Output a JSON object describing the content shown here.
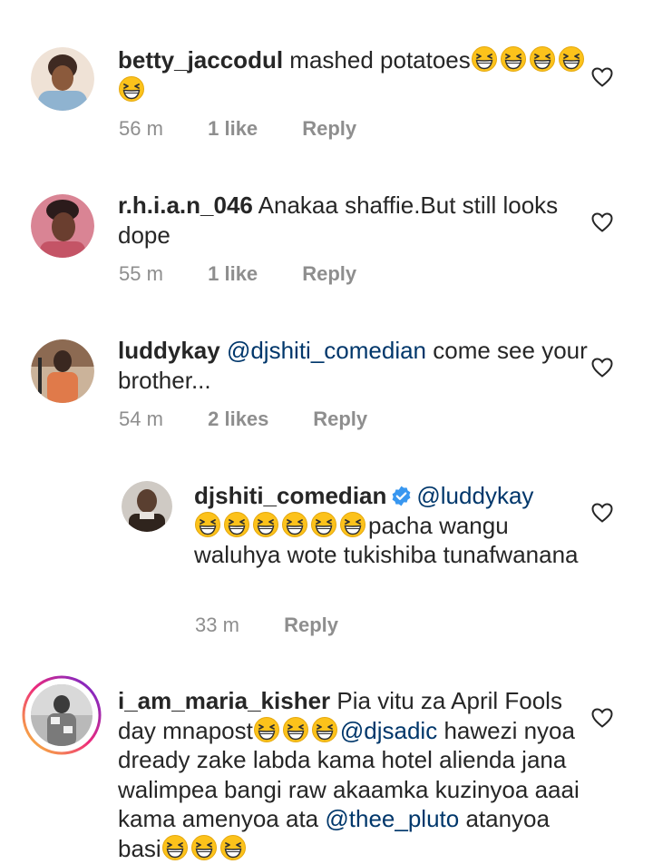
{
  "comments": [
    {
      "username": "betty_jaccodul",
      "text_before": "mashed potatoes",
      "emoji_count": 5,
      "time": "56 m",
      "likes": "1 like",
      "reply": "Reply",
      "avatar_colors": [
        "#f1d7c0",
        "#3f2a22",
        "#8fb3d0"
      ]
    },
    {
      "username": "r.h.i.a.n_046",
      "text": "Anakaa shaffie.But still looks dope",
      "time": "55 m",
      "likes": "1 like",
      "reply": "Reply",
      "avatar_colors": [
        "#d76b7a",
        "#2b1b1b",
        "#6a2e3a"
      ]
    },
    {
      "username": "luddykay",
      "mention": "@djshiti_comedian",
      "text": "come see your brother...",
      "time": "54 m",
      "likes": "2 likes",
      "reply": "Reply",
      "avatar_colors": [
        "#d9c4ad",
        "#3a2820",
        "#9b7359"
      ]
    },
    {
      "username": "djshiti_comedian",
      "mention": "@luddykay",
      "emoji_count": 6,
      "text": "pacha wangu waluhya wote tukishiba tunafwanana",
      "time": "33 m",
      "reply": "Reply",
      "avatar_colors": [
        "#c7c2bd",
        "#2f241d",
        "#7a7067"
      ]
    },
    {
      "username": "i_am_maria_kisher",
      "text_line1": "Pia vitu za April Fools day mnapost",
      "emoji_count_mid": 3,
      "mention1": "@djsadic",
      "text_line2": "hawezi nyoa dready zake labda kama hotel alienda jana walimpea bangi raw akaamka kuzinyoa aaai kama amenyoa ata",
      "mention2": "@thee_pluto",
      "text_line3": "atanyoa basi",
      "emoji_count_end": 3,
      "avatar_colors": [
        "#a9a9a9",
        "#e8e8e8",
        "#3b3b3b"
      ]
    }
  ],
  "colors": {
    "text": "#262626",
    "meta": "#8e8e8e",
    "mention": "#00376b",
    "verified": "#3897f0"
  }
}
